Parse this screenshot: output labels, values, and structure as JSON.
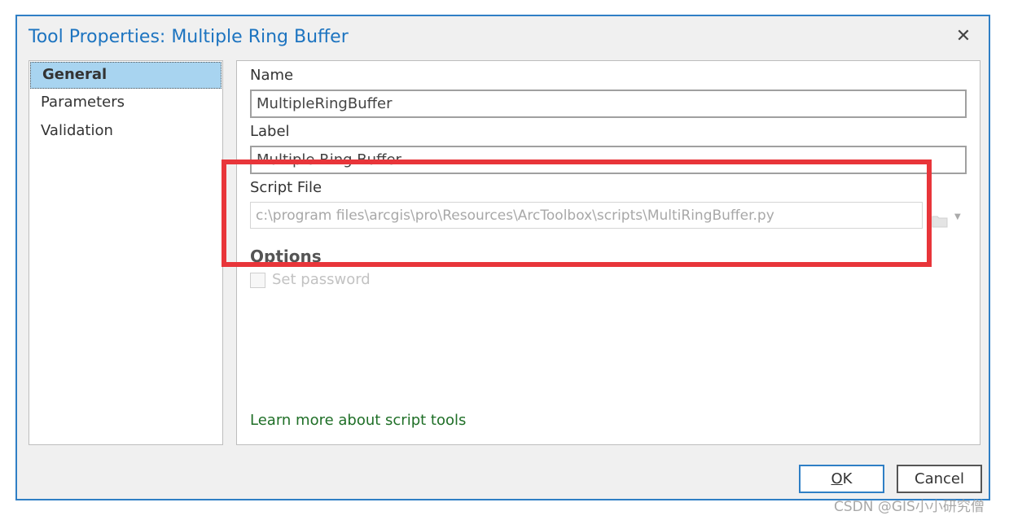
{
  "window": {
    "title": "Tool Properties: Multiple Ring Buffer",
    "close_icon": "close-icon"
  },
  "nav": {
    "items": [
      {
        "label": "General",
        "selected": true
      },
      {
        "label": "Parameters",
        "selected": false
      },
      {
        "label": "Validation",
        "selected": false
      }
    ]
  },
  "general": {
    "name_label": "Name",
    "name_value": "MultipleRingBuffer",
    "label_label": "Label",
    "label_value": "Multiple Ring Buffer",
    "script_file_label": "Script File",
    "script_file_value": "c:\\program files\\arcgis\\pro\\Resources\\ArcToolbox\\scripts\\MultiRingBuffer.py",
    "options_heading": "Options",
    "set_password_label": "Set password",
    "help_link": "Learn more about script tools"
  },
  "buttons": {
    "ok_accel": "O",
    "ok_rest": "K",
    "cancel": "Cancel"
  },
  "watermark": "CSDN @GIS小小研究僧",
  "colors": {
    "accent": "#2f7fc5",
    "title": "#1d74c0",
    "selected": "#a8d4f0",
    "highlight": "#e8353a",
    "link": "#1f6f27"
  }
}
